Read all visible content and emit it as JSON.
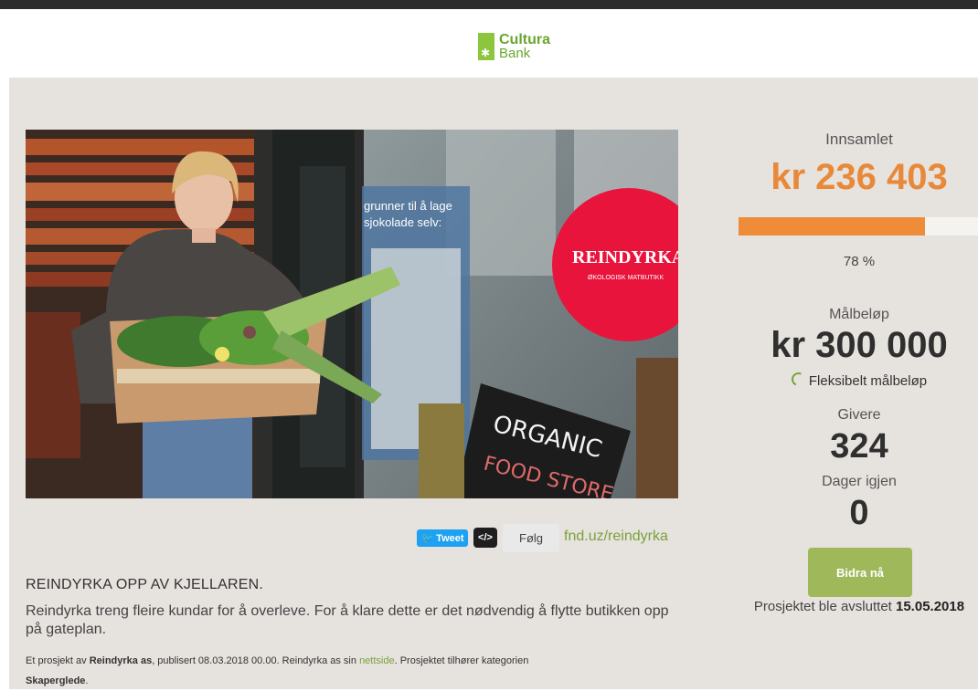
{
  "brand": {
    "logo_line1": "Cultura",
    "logo_line2": "Bank",
    "accent": "#e8893a",
    "green": "#7aa23a"
  },
  "photo": {
    "sign_text_1": "REINDYRKA",
    "sign_text_2": "ØKOLOGISK MATBUTIKK",
    "chalkboard_line1": "ORGANIC",
    "chalkboard_line2": "FOOD STORE",
    "window_text_1": "grunner til å lage",
    "window_text_2": "sjokolade selv:"
  },
  "share": {
    "tweet_label": "Tweet",
    "embed_label": "</>",
    "follow_label": "Følg",
    "short_url": "fnd.uz/reindyrka"
  },
  "project": {
    "title": "REINDYRKA OPP AV KJELLAREN.",
    "description": "Reindyrka treng fleire kundar for å overleve. For å klare dette er det nødvendig å flytte butikken opp på gateplan.",
    "meta_prefix": "Et prosjekt av ",
    "owner": "Reindyrka as",
    "meta_published": ", publisert 08.03.2018 00.00. Reindyrka as sin ",
    "website_link": "nettside",
    "meta_category_text": ". Prosjektet tilhører kategorien",
    "category": "Skaperglede",
    "meta_end": "."
  },
  "stats": {
    "collected_label": "Innsamlet",
    "collected_amount": "kr 236 403",
    "progress_percent": 78,
    "progress_label": "78 %",
    "goal_label": "Målbeløp",
    "goal_amount": "kr 300 000",
    "flexible_label": "Fleksibelt målbeløp",
    "givers_label": "Givere",
    "givers_count": "324",
    "days_label": "Dager igjen",
    "days_count": "0",
    "contribute_label": "Bidra nå",
    "ended_prefix": "Prosjektet ble avsluttet ",
    "ended_date": "15.05.2018"
  }
}
